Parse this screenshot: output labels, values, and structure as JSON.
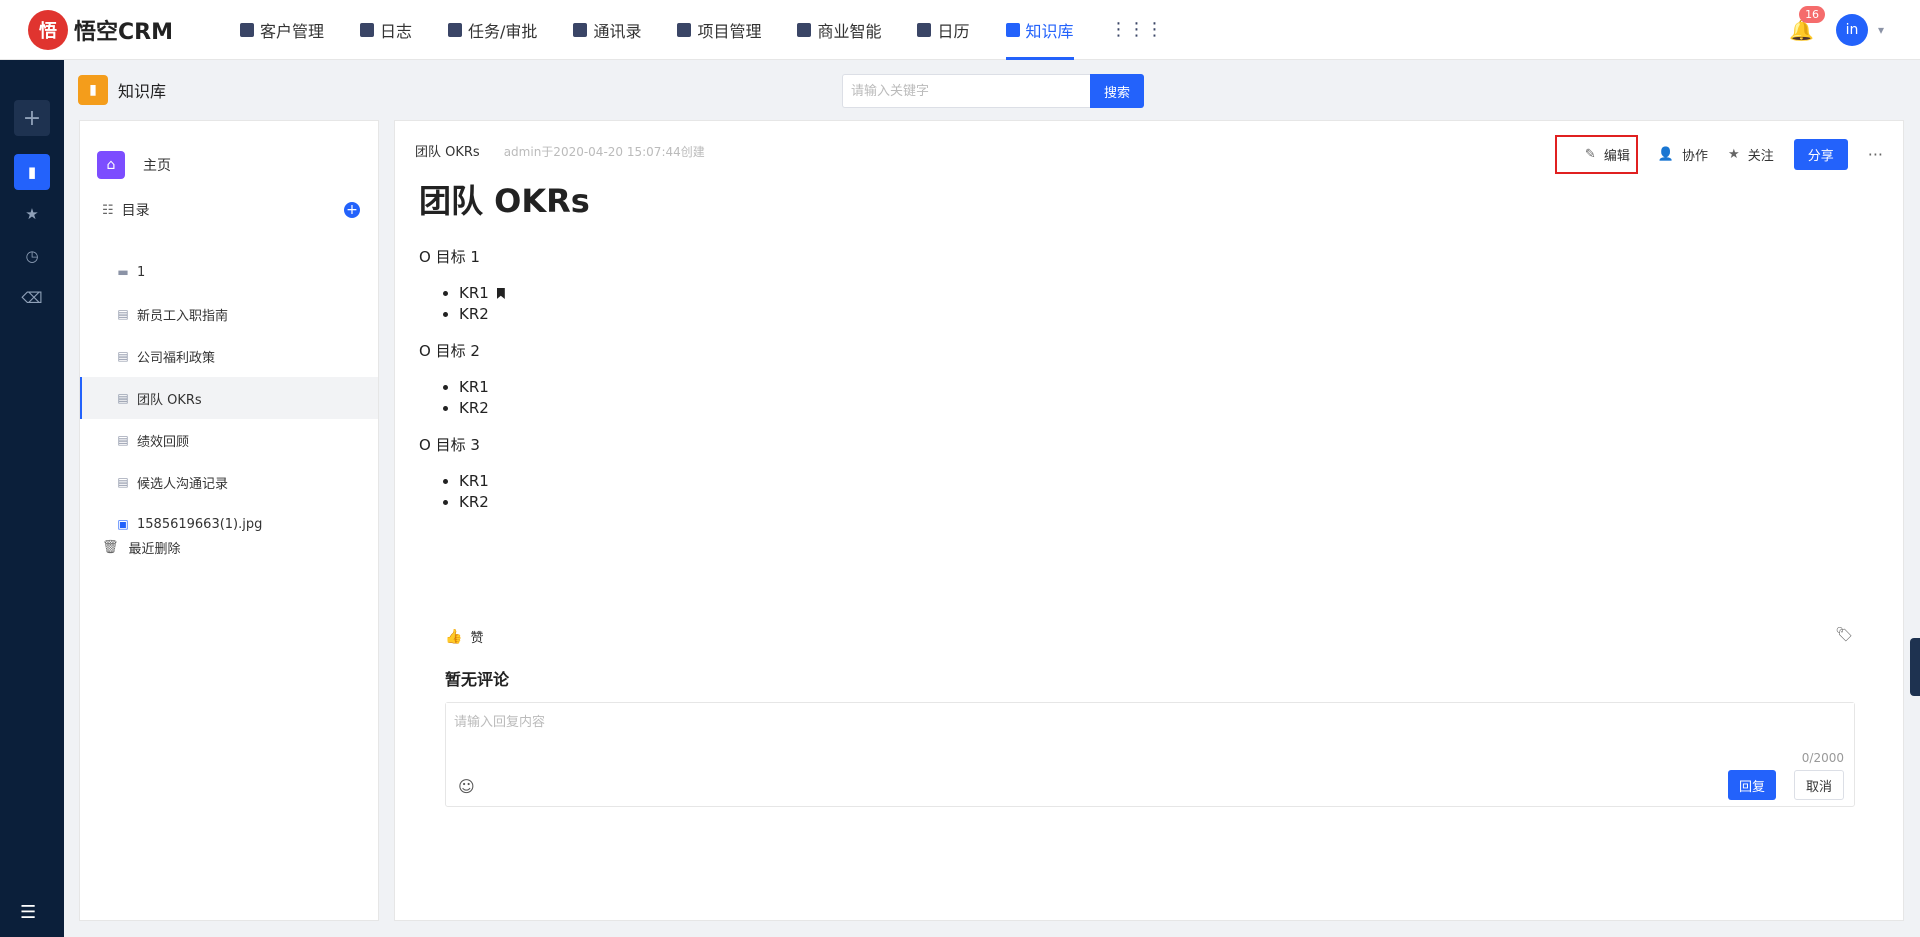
{
  "brand": {
    "logo_glyph": "悟",
    "name": "悟空CRM"
  },
  "nav": [
    {
      "label": "客户管理",
      "icon": "building-icon"
    },
    {
      "label": "日志",
      "icon": "log-icon"
    },
    {
      "label": "任务/审批",
      "icon": "briefcase-icon"
    },
    {
      "label": "通讯录",
      "icon": "phone-book-icon"
    },
    {
      "label": "项目管理",
      "icon": "project-icon"
    },
    {
      "label": "商业智能",
      "icon": "bi-icon"
    },
    {
      "label": "日历",
      "icon": "calendar-icon"
    },
    {
      "label": "知识库",
      "icon": "book-icon",
      "active": true
    }
  ],
  "notifications": {
    "count": "16"
  },
  "user": {
    "avatar_text": "in"
  },
  "page": {
    "title": "知识库",
    "search_placeholder": "请输入关键字",
    "search_button": "搜索"
  },
  "tree": {
    "home_label": "主页",
    "directory_label": "目录",
    "items": [
      {
        "label": "1",
        "icon": "folder-icon"
      },
      {
        "label": "新员工入职指南",
        "icon": "doc-icon"
      },
      {
        "label": "公司福利政策",
        "icon": "doc-icon"
      },
      {
        "label": "团队 OKRs",
        "icon": "doc-icon",
        "active": true
      },
      {
        "label": "绩效回顾",
        "icon": "doc-icon"
      },
      {
        "label": "候选人沟通记录",
        "icon": "doc-icon"
      },
      {
        "label": "1585619663(1).jpg",
        "icon": "image-file-icon"
      }
    ],
    "trash_label": "最近删除"
  },
  "document": {
    "crumb": "团队 OKRs",
    "meta": "admin于2020-04-20 15:07:44创建",
    "title": "团队 OKRs",
    "goals": [
      {
        "title": "O 目标 1",
        "krs": [
          "KR1",
          "KR2"
        ]
      },
      {
        "title": "O 目标 2",
        "krs": [
          "KR1",
          "KR2"
        ]
      },
      {
        "title": "O 目标 3",
        "krs": [
          "KR1",
          "KR2"
        ]
      }
    ]
  },
  "toolbar": {
    "edit": "编辑",
    "collaborate": "协作",
    "follow": "关注",
    "share": "分享"
  },
  "comments": {
    "like": "赞",
    "empty": "暂无评论",
    "placeholder": "请输入回复内容",
    "counter": "0/2000",
    "reply": "回复",
    "cancel": "取消"
  },
  "colors": {
    "accent": "#2362fb",
    "rail": "#0b1f3a",
    "highlight": "#e02020"
  }
}
